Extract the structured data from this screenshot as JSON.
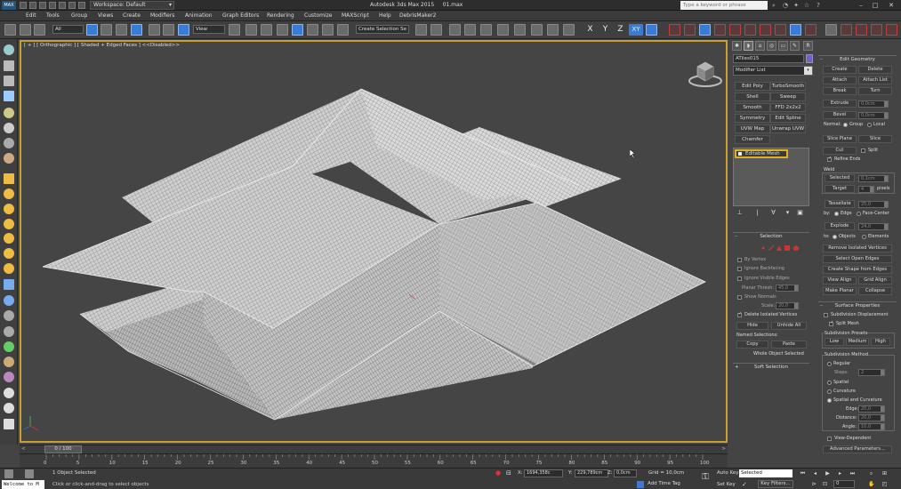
{
  "titlebar": {
    "logo": "MAX",
    "workspace": "Workspace: Default",
    "app_title": "Autodesk 3ds Max 2015",
    "file_name": "01.max",
    "search_placeholder": "Type a keyword or phrase"
  },
  "menu": [
    "Edit",
    "Tools",
    "Group",
    "Views",
    "Create",
    "Modifiers",
    "Animation",
    "Graph Editors",
    "Rendering",
    "Customize",
    "MAXScript",
    "Help",
    "DebrisMaker2"
  ],
  "toolbar": {
    "selection_filter": "All",
    "ref_coord": "View",
    "named_selection": "Create Selection Se",
    "axes": [
      "X",
      "Y",
      "Z",
      "XY"
    ]
  },
  "viewport": {
    "label": "[ + ] [ Orthographic ] [ Shaded + Edged Faces ]  <<Disabled>>"
  },
  "command_panel": {
    "object_name": "ATiles015",
    "modifier_list": "Modifier List",
    "modifier_buttons": [
      "Edit Poly",
      "TurboSmooth",
      "Shell",
      "Sweep",
      "Smooth",
      "FFD 2x2x2",
      "Symmetry",
      "Edit Spline",
      "UVW Map",
      "Unwrap UVW",
      "Chamfer"
    ],
    "stack_item": "Editable Mesh",
    "selection": {
      "title": "Selection",
      "by_vertex": "By Vertex",
      "ignore_backfacing": "Ignore Backfacing",
      "ignore_visible_edges": "Ignore Visible Edges",
      "planar_thresh_label": "Planar Thresh:",
      "planar_thresh": "45,0",
      "show_normals": "Show Normals",
      "scale_label": "Scale:",
      "scale": "20,0",
      "delete_isolated": "Delete Isolated Vertices",
      "hide": "Hide",
      "unhide_all": "Unhide All",
      "named_selections": "Named Selections:",
      "copy": "Copy",
      "paste": "Paste",
      "whole_object": "Whole Object Selected"
    },
    "soft_selection": "Soft Selection",
    "edit_geometry": {
      "title": "Edit Geometry",
      "create": "Create",
      "delete": "Delete",
      "attach": "Attach",
      "attach_list": "Attach List",
      "break": "Break",
      "turn": "Turn",
      "extrude": "Extrude",
      "extrude_val": "0,0cm",
      "bevel": "Bevel",
      "bevel_val": "0,0cm",
      "normal_label": "Normal:",
      "group": "Group",
      "local": "Local",
      "slice_plane": "Slice Plane",
      "slice": "Slice",
      "cut": "Cut",
      "split": "Split",
      "refine_ends": "Refine Ends",
      "weld": "Weld",
      "selected": "Selected",
      "selected_val": "0,1cm",
      "target": "Target",
      "target_val": "4",
      "pixels": "pixels",
      "tessellate": "Tessellate",
      "tess_val": "25,0",
      "by_label": "by:",
      "edge": "Edge",
      "face_center": "Face-Center",
      "explode": "Explode",
      "explode_val": "24,0",
      "to_label": "to:",
      "objects": "Objects",
      "elements": "Elements",
      "remove_isolated": "Remove Isolated Vertices",
      "select_open_edges": "Select Open Edges",
      "create_shape": "Create Shape from Edges",
      "view_align": "View Align",
      "grid_align": "Grid Align",
      "make_planar": "Make Planar",
      "collapse": "Collapse"
    },
    "surface_properties": {
      "title": "Surface Properties",
      "subdivision_displacement": "Subdivision Displacement",
      "split_mesh": "Split Mesh",
      "presets_title": "Subdivision Presets",
      "low": "Low",
      "medium": "Medium",
      "high": "High",
      "method_title": "Subdivision Method",
      "regular": "Regular",
      "steps": "Steps:",
      "steps_val": "2",
      "spatial": "Spatial",
      "curvature": "Curvature",
      "spatial_curvature": "Spatial and Curvature",
      "edge_label": "Edge:",
      "edge_val": "20,0",
      "distance_label": "Distance:",
      "distance_val": "20,0",
      "angle_label": "Angle:",
      "angle_val": "10,0",
      "view_dependent": "View-Dependent",
      "advanced": "Advanced Parameters..."
    }
  },
  "timeline": {
    "frame_readout": "0 / 100",
    "ticks": [
      0,
      5,
      10,
      15,
      20,
      25,
      30,
      35,
      40,
      45,
      50,
      55,
      60,
      65,
      70,
      75,
      80,
      85,
      90,
      95,
      100
    ]
  },
  "status": {
    "maxscript": "Welcome to M",
    "line1": "1 Object Selected",
    "line2": "Click or click-and-drag to select objects",
    "x_label": "X:",
    "x": "1694,358c",
    "y_label": "Y:",
    "y": "229,789cm",
    "z_label": "Z:",
    "z": "0,0cm",
    "grid": "Grid = 10,0cm",
    "add_time_tag": "Add Time Tag",
    "auto_key": "Auto Key",
    "set_key": "Set Key",
    "selected_mode": "Selected",
    "key_filters": "Key Filters...",
    "frame": "0"
  },
  "colors": {
    "accent_blue": "#3a7bd5",
    "viewport_border": "#c8a02a",
    "stack_highlight": "#e0b020",
    "object_color": "#6b5fd8"
  }
}
